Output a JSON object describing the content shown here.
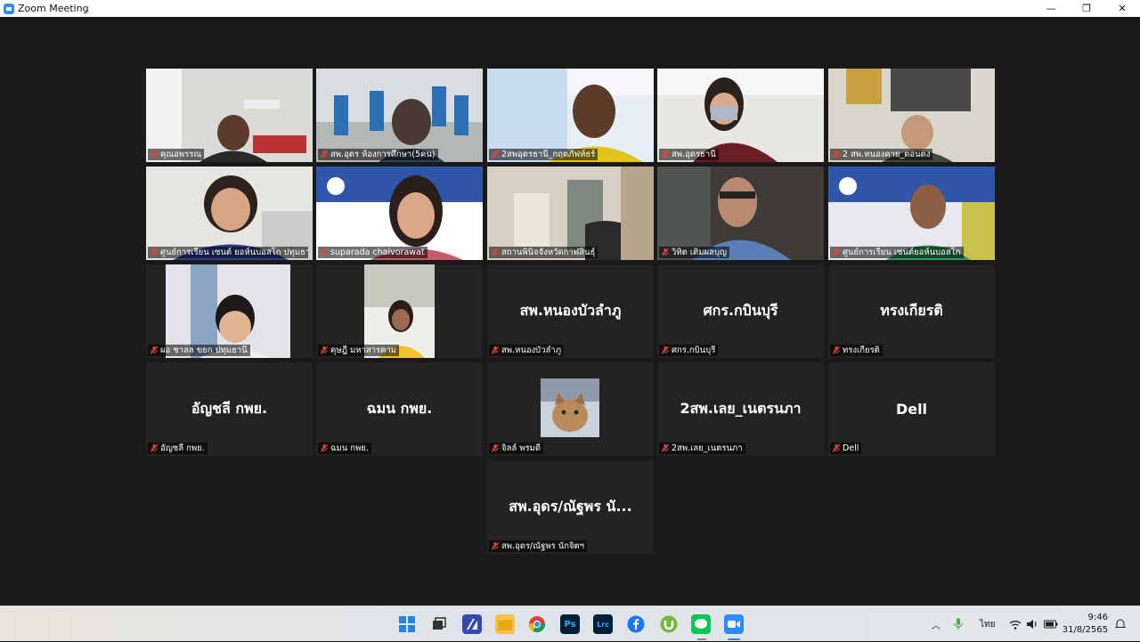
{
  "window": {
    "title": "Zoom Meeting",
    "minimize": "—",
    "maximize": "❐",
    "close": "✕"
  },
  "participants": [
    {
      "label": "คุณอพรรณ",
      "video": true,
      "scene": "office-woman"
    },
    {
      "label": "สพ.อุดร ห้องการศึกษา(5คน)",
      "video": true,
      "scene": "group"
    },
    {
      "label": "2สพอุดรธานี_กฤตภัฟห์ธร์",
      "video": true,
      "scene": "slide-man"
    },
    {
      "label": "สพ.อุดรธานี",
      "video": true,
      "scene": "woman-mask"
    },
    {
      "label": "2 สพ.หนองคาย_ดอนดง",
      "video": true,
      "scene": "office-man"
    },
    {
      "label": "ศูนย์การเรียน เซนต์ ยอห์นบอสโก ปทุมธานี",
      "video": true,
      "scene": "woman-blue"
    },
    {
      "label": "suparada chaivorawat",
      "video": true,
      "scene": "woman-banner"
    },
    {
      "label": "สถานพินิจจังหวัดกาฬสินธุ์",
      "video": true,
      "scene": "empty-office"
    },
    {
      "label": "วิทิต เติมผลบุญ",
      "video": true,
      "scene": "old-man",
      "active": true
    },
    {
      "label": "ศูนย์การเรียน เซนต์ยอห์นบอสโก",
      "video": true,
      "scene": "man-banner"
    },
    {
      "label": "ผอ ชาลล ขยก ปทุมธานี",
      "video": true,
      "scene": "young-man"
    },
    {
      "label": "คุษฎี มหาสารคาม",
      "video": true,
      "scene": "woman-dark"
    },
    {
      "label": "สพ.หนองบัวลำภู",
      "display": "สพ.หนองบัวลำภู",
      "video": false
    },
    {
      "label": "ศกร.กบินบุรี",
      "display": "ศกร.กบินบุรี",
      "video": false
    },
    {
      "label": "ทรงเกียรติ",
      "display": "ทรงเกียรติ",
      "video": false
    },
    {
      "label": "อัญชลี กพย.",
      "display": "อัญชลี กพย.",
      "video": false
    },
    {
      "label": "ฉมน กพย.",
      "display": "ฉมน กพย.",
      "video": false
    },
    {
      "label": "จิลล์ พรมดี",
      "video": false,
      "avatar": "cat"
    },
    {
      "label": "2สพ.เลย_เนตรนภา",
      "display": "2สพ.เลย_เนตรนภา",
      "video": false
    },
    {
      "label": "Dell",
      "display": "Dell",
      "video": false
    },
    {
      "label": "สพ.อุดร/ณัฐพร นักจิตฯ",
      "display": "สพ.อุดร/ณัฐพร นั...",
      "video": false
    }
  ],
  "taskbar": {
    "icons": [
      "windows-start-icon",
      "task-view-icon",
      "mspaint-icon",
      "file-explorer-icon",
      "chrome-icon",
      "photoshop-icon",
      "lightroom-icon",
      "facebook-icon",
      "utorrent-icon",
      "line-icon",
      "zoom-icon"
    ],
    "photoshop_text": "Ps",
    "lightroom_text": "Lrc",
    "language": "ไทย",
    "time": "9:46",
    "date": "31/8/2565"
  },
  "colors": {
    "active_speaker": "#b8e04a",
    "muted_mic": "#e0443a",
    "zoom_blue": "#2d8cff"
  }
}
